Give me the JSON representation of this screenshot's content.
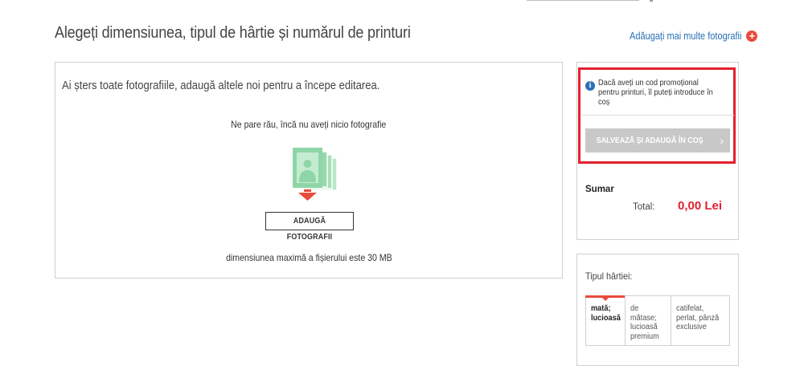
{
  "header": {
    "title": "Alegeți dimensiunea, tipul de hârtie și numărul de printuri",
    "add_more_label": "Adăugați mai multe fotografii"
  },
  "main": {
    "deleted_message": "Ai șters toate fotografiile, adaugă altele noi pentru a începe editarea.",
    "no_photos_message": "Ne pare rău, încă nu aveți nicio fotografie",
    "add_photos_button": "ADAUGĂ FOTOGRAFII",
    "max_size_note": "dimensiunea maximă a fișierului este 30 MB"
  },
  "sidebar": {
    "promo_text": "Dacă aveți un cod promoțional pentru printuri, îl puteți introduce în coș",
    "save_button": "SALVEAZĂ ȘI ADAUGĂ ÎN COȘ",
    "summary_title": "Sumar",
    "total_label": "Total:",
    "total_value": "0,00 Lei",
    "paper_type_title": "Tipul hârtiei:",
    "paper_tabs": [
      {
        "label": "mată; lucioasă"
      },
      {
        "label": "de mătase; lucioasă premium"
      },
      {
        "label": "catifelat, perlat, pânză exclusive"
      }
    ]
  },
  "icons": {
    "add_more": "plus-circle-icon",
    "info": "info-icon",
    "chevron": "chevron-right-icon",
    "photos": "photo-stack-icon"
  },
  "colors": {
    "accent_red": "#e4202e",
    "link_blue": "#2a6fb5",
    "photo_green": "#8fd6a6",
    "disabled_button": "#c8c8c8"
  }
}
